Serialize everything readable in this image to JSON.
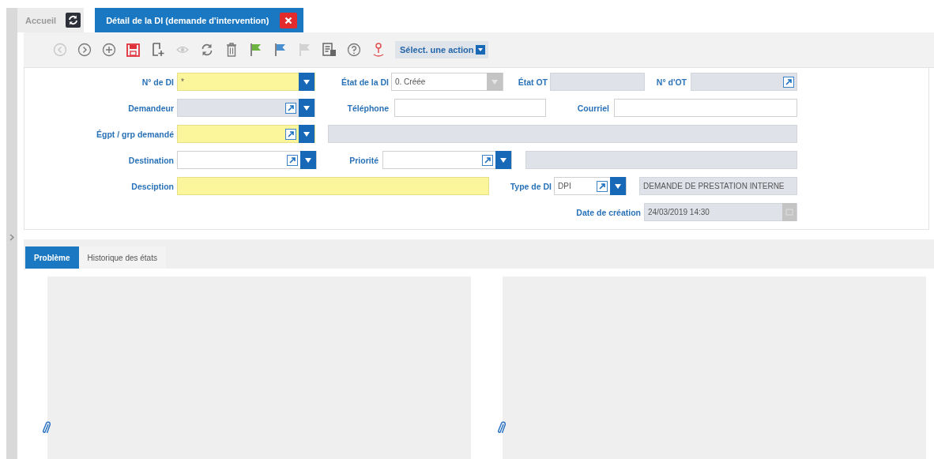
{
  "tabs": [
    {
      "label": "Accueil",
      "selected": false,
      "refreshable": true,
      "closable": false
    },
    {
      "label": "Détail de la DI (demande d'intervention)",
      "selected": true,
      "refreshable": false,
      "closable": true
    }
  ],
  "toolbar": {
    "buttons": [
      {
        "kind": "previous",
        "disabled": true
      },
      {
        "kind": "next",
        "disabled": false
      },
      {
        "kind": "add",
        "disabled": false
      },
      {
        "kind": "save",
        "disabled": false
      },
      {
        "kind": "new-document",
        "disabled": false
      },
      {
        "kind": "view",
        "disabled": true
      },
      {
        "kind": "refresh",
        "disabled": false
      },
      {
        "kind": "delete",
        "disabled": false
      },
      {
        "kind": "flag-green",
        "disabled": false
      },
      {
        "kind": "flag-blue",
        "disabled": false
      },
      {
        "kind": "flag",
        "disabled": true
      },
      {
        "kind": "report",
        "disabled": false
      },
      {
        "kind": "help",
        "disabled": false
      },
      {
        "kind": "user-pin",
        "disabled": false
      }
    ],
    "action_select": "Sélect. une action"
  },
  "form": {
    "lines": [
      {
        "fields": [
          {
            "label": "N° de DI",
            "value": "*",
            "required": true,
            "readonly": false,
            "link": false,
            "button": {
              "kind": "dropdown",
              "disabled": false
            }
          },
          {
            "label": "État de la DI",
            "value": "0. Créée",
            "required": false,
            "readonly": false,
            "link": false,
            "button": {
              "kind": "dropdown",
              "disabled": true
            }
          },
          {
            "label": "État OT",
            "required": false,
            "readonly": true,
            "link": false
          },
          {
            "label": "N° d'OT",
            "required": false,
            "readonly": true,
            "link": true
          }
        ]
      },
      {
        "fields": [
          {
            "label": "Demandeur",
            "required": false,
            "readonly": true,
            "link": true,
            "button": {
              "kind": "dropdown",
              "disabled": false
            }
          },
          {
            "label": "Téléphone",
            "required": false,
            "readonly": false,
            "link": false
          },
          {
            "label": "Courriel",
            "required": false,
            "readonly": false,
            "link": false
          }
        ]
      },
      {
        "fields": [
          {
            "label": "Égpt / grp demandé",
            "required": true,
            "readonly": false,
            "link": true,
            "button": {
              "kind": "dropdown",
              "disabled": false
            }
          },
          {
            "required": false,
            "readonly": true,
            "link": false
          }
        ]
      },
      {
        "fields": [
          {
            "label": "Destination",
            "required": false,
            "readonly": false,
            "link": true,
            "button": {
              "kind": "dropdown",
              "disabled": false
            }
          },
          {
            "label": "Priorité",
            "required": false,
            "readonly": false,
            "link": true,
            "button": {
              "kind": "dropdown",
              "disabled": false
            }
          },
          {
            "required": false,
            "readonly": true,
            "link": false
          }
        ]
      },
      {
        "fields": [
          {
            "label": "Desciption",
            "required": true,
            "readonly": false,
            "link": false
          },
          {
            "label": "Type de DI",
            "value": "DPI",
            "required": false,
            "readonly": false,
            "link": true,
            "button": {
              "kind": "dropdown",
              "disabled": false
            }
          },
          {
            "value": "DEMANDE DE PRESTATION INTERNE",
            "required": false,
            "readonly": true,
            "link": false
          }
        ]
      },
      {
        "fields": [
          {
            "label": "Date de création",
            "value": "24/03/2019 14:30",
            "required": false,
            "readonly": true,
            "link": false,
            "button": {
              "kind": "calendar",
              "disabled": true
            }
          }
        ]
      }
    ]
  },
  "detail_tabs": [
    {
      "label": "Problème",
      "selected": true
    },
    {
      "label": "Historique des états",
      "selected": false
    }
  ]
}
